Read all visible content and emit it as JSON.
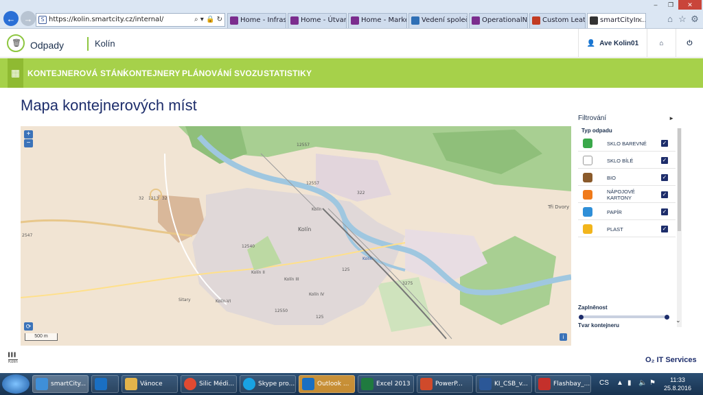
{
  "browser": {
    "url": "https://kolin.smartcity.cz/internal/",
    "tabs": [
      {
        "label": "Home - Infrast...",
        "color": "#7b2d8e"
      },
      {
        "label": "Home - Útvary...",
        "color": "#7b2d8e"
      },
      {
        "label": "Home - Marke...",
        "color": "#7b2d8e"
      },
      {
        "label": "Vedení společ...",
        "color": "#2f6fb5"
      },
      {
        "label": "OperationalNe...",
        "color": "#7b2d8e"
      },
      {
        "label": "Custom Leath...",
        "color": "#c23b22"
      },
      {
        "label": "smartCityIn...",
        "color": "#333333"
      }
    ],
    "close_glyph": "×"
  },
  "app": {
    "brand": "Odpady",
    "city": "Kolín",
    "user": "Ave Kolin01",
    "menu": [
      "KONTEJNEROVÁ STÁNÍ",
      "KONTEJNERY",
      "PLÁNOVÁNÍ SVOZU",
      "STATISTIKY"
    ],
    "accent": "#a6d14a",
    "title_color": "#1d2d6b"
  },
  "page": {
    "title": "Mapa kontejnerových míst"
  },
  "map": {
    "zoom_in": "+",
    "zoom_out": "−",
    "scale": "500 m",
    "info": "i",
    "labels": [
      "12557",
      "12557",
      "Kolín",
      "Kolín",
      "Kolín II",
      "Kolín III",
      "Kolín IV",
      "Kolín-VI",
      "Sitary",
      "12540",
      "12550",
      "125",
      "125",
      "3275",
      "322",
      "Tři Dvory",
      "1213",
      "32",
      "32",
      "2547",
      "Kolín"
    ]
  },
  "filter": {
    "title": "Filtrování",
    "type_title": "Typ odpadu",
    "types": [
      {
        "label": "SKLO BAREVNÉ",
        "color": "#3aa84a",
        "checked": true
      },
      {
        "label": "SKLO BÍLÉ",
        "color": "#ffffff",
        "checked": true
      },
      {
        "label": "BIO",
        "color": "#8a5a2b",
        "checked": true
      },
      {
        "label": "NÁPOJOVÉ KARTONY",
        "color": "#f07a1a",
        "checked": true
      },
      {
        "label": "PAPÍR",
        "color": "#2f8fd8",
        "checked": true
      },
      {
        "label": "PLAST",
        "color": "#f2b51c",
        "checked": true
      }
    ],
    "fill_title": "Zaplněnost",
    "shape_title": "Tvar kontejneru"
  },
  "footer": {
    "logo_text": "Kolín",
    "brand": "O₂ IT Services"
  },
  "taskbar": {
    "items": [
      {
        "label": "smartCity...",
        "color": "#3f8fd8"
      },
      {
        "label": "",
        "color": "#1a6fc2"
      },
      {
        "label": "Vánoce",
        "color": "#e3b44b"
      },
      {
        "label": "Silic Médi...",
        "color": "#e04a32"
      },
      {
        "label": "Skype pro...",
        "color": "#19a3e3"
      },
      {
        "label": "Outlook ...",
        "color": "#1a6fc2"
      },
      {
        "label": "Excel 2013",
        "color": "#1f7a3f"
      },
      {
        "label": "PowerP...",
        "color": "#d04a2b"
      },
      {
        "label": "KI_CSB_v...",
        "color": "#2b5797"
      },
      {
        "label": "Flashbay_...",
        "color": "#c4302b"
      }
    ],
    "lang": "CS",
    "time": "11:33",
    "date": "25.8.2016"
  }
}
